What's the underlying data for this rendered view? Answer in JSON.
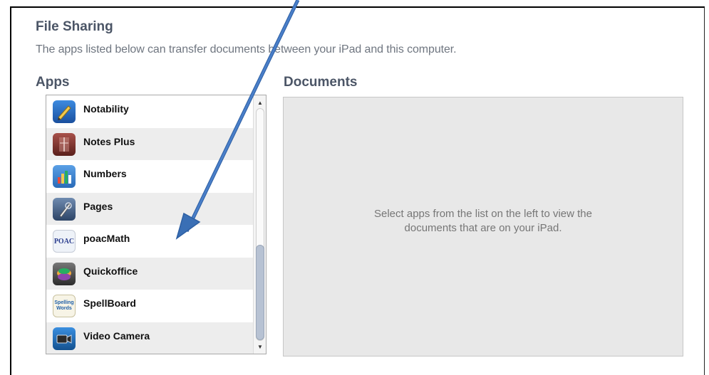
{
  "header": {
    "title": "File Sharing",
    "subtitle": "The apps listed below can transfer documents between your iPad and this computer."
  },
  "columns": {
    "apps_title": "Apps",
    "documents_title": "Documents"
  },
  "apps": [
    {
      "name": "Notability",
      "icon": "notability-icon"
    },
    {
      "name": "Notes Plus",
      "icon": "notes-plus-icon"
    },
    {
      "name": "Numbers",
      "icon": "numbers-icon"
    },
    {
      "name": "Pages",
      "icon": "pages-icon"
    },
    {
      "name": "poacMath",
      "icon": "poacmath-icon"
    },
    {
      "name": "Quickoffice",
      "icon": "quickoffice-icon"
    },
    {
      "name": "SpellBoard",
      "icon": "spellboard-icon"
    },
    {
      "name": "Video Camera",
      "icon": "video-camera-icon"
    }
  ],
  "icon_text": {
    "poac": "POAC",
    "spelling": "Spelling",
    "words": "Words"
  },
  "documents": {
    "empty_message": "Select apps from the list on the left to view the documents that are on your iPad."
  },
  "colors": {
    "heading": "#4b5566",
    "arrow": "#3a6fb5",
    "scroll_thumb": "#b7c2d3"
  }
}
